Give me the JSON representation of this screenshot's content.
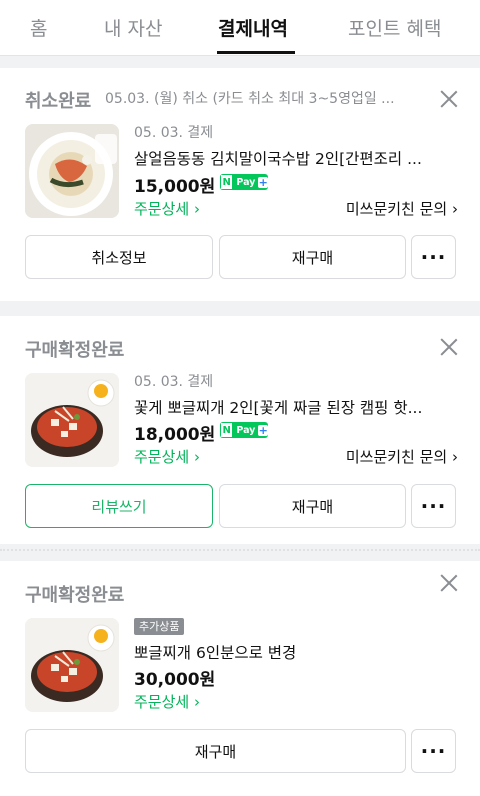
{
  "tabs": [
    {
      "label": "홈"
    },
    {
      "label": "내 자산"
    },
    {
      "label": "결제내역"
    },
    {
      "label": "포인트 혜택"
    }
  ],
  "orders": [
    {
      "status": "취소완료",
      "status_note": "05.03. (월) 취소 (카드 취소 최대 3~5영업일 ...",
      "date_label": "05. 03. 결제",
      "title": "살얼음동동 김치말이국수밥 2인[간편조리 ...",
      "price": "15,000원",
      "npay_label": "Pay",
      "detail_link": "주문상세",
      "store_link": "미쓰문키친 문의",
      "buttons": [
        "취소정보",
        "재구매",
        "···"
      ]
    },
    {
      "status": "구매확정완료",
      "date_label": "05. 03. 결제",
      "title": "꽃게 뽀글찌개 2인[꽃게 짜글 된장 캠핑 핫...",
      "price": "18,000원",
      "npay_label": "Pay",
      "detail_link": "주문상세",
      "store_link": "미쓰문키친 문의",
      "buttons": [
        "리뷰쓰기",
        "재구매",
        "···"
      ]
    },
    {
      "status": "구매확정완료",
      "badge": "추가상품",
      "title": "뽀글찌개 6인분으로 변경",
      "price": "30,000원",
      "detail_link": "주문상세",
      "buttons": [
        "재구매",
        "···"
      ]
    }
  ],
  "colors": {
    "accent_green": "#03c75a",
    "text_muted": "#8a8d92",
    "background": "#f1f2f4"
  }
}
